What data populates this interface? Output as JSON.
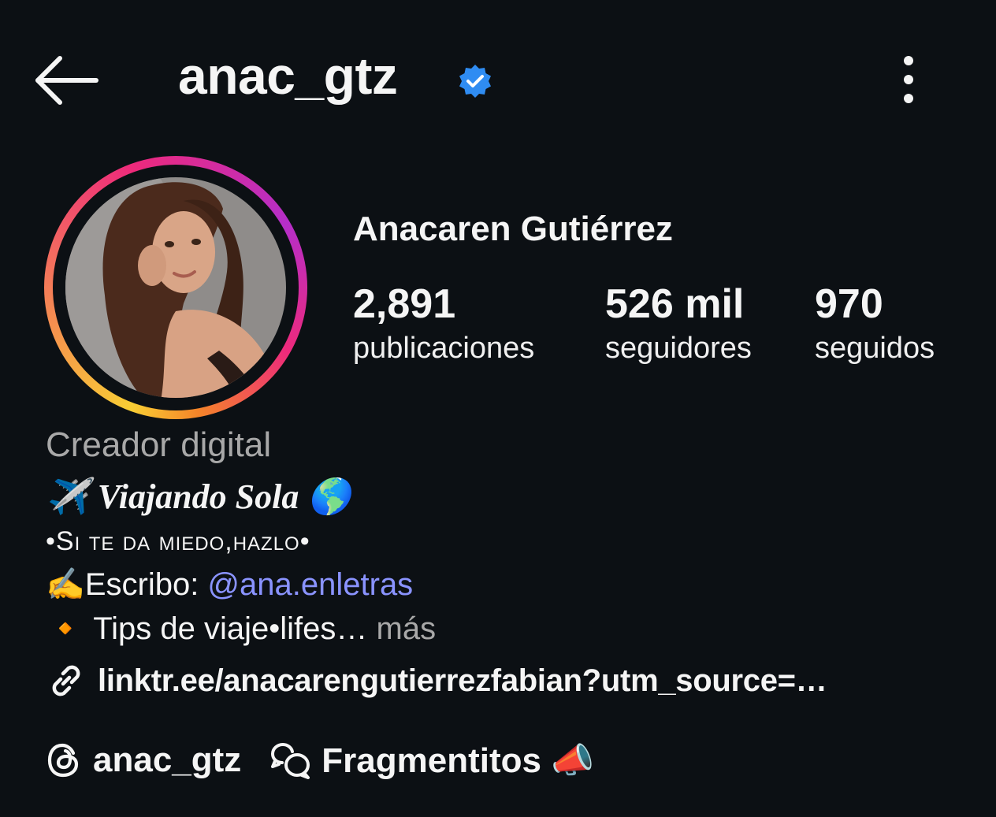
{
  "header": {
    "username": "anac_gtz",
    "back_icon": "arrow-left-icon",
    "verified_icon": "verified-badge-icon",
    "more_icon": "more-vertical-icon"
  },
  "profile": {
    "full_name": "Anacaren Gutiérrez",
    "stats": [
      {
        "value": "2,891",
        "label": "publicaciones"
      },
      {
        "value": "526 mil",
        "label": "seguidores"
      },
      {
        "value": "970",
        "label": "seguidos"
      }
    ],
    "category": "Creador digital",
    "bio": {
      "line1_emoji_start": "✈️",
      "line1_text": "Viajando Sola",
      "line1_emoji_end": "🌎",
      "line2": "•Si te da miedo,hazlo•",
      "line3_emoji": "✍️",
      "line3_prefix": "Escribo: ",
      "line3_mention": "@ana.enletras",
      "line4_bullet": "🔸",
      "line4_text": "Tips de viaje•lifes…",
      "line4_more": "más"
    },
    "link": {
      "icon": "link-icon",
      "text": "linktr.ee/anacarengutierrezfabian?utm_source=…"
    },
    "threads": {
      "icon": "threads-icon",
      "label": "anac_gtz"
    },
    "channel": {
      "icon": "chat-bubbles-icon",
      "label": "Fragmentitos 📣"
    }
  },
  "colors": {
    "background": "#0c1014",
    "text": "#f5f5f5",
    "secondary": "#a8a8a8",
    "mention": "#8a93ff",
    "verified": "#2f8cf2"
  }
}
